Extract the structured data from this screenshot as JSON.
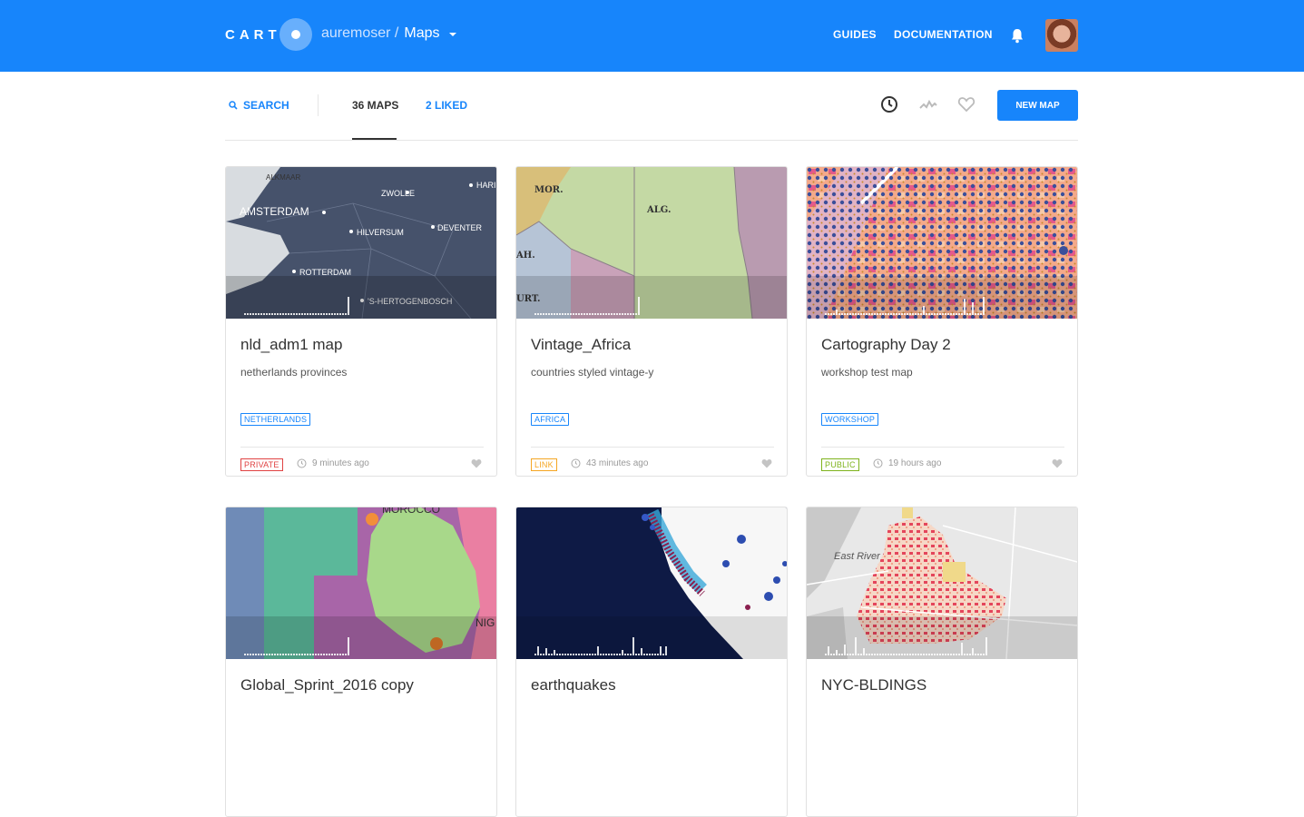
{
  "header": {
    "logo_text": "CART",
    "username": "auremoser /",
    "section": "Maps",
    "links": {
      "guides": "GUIDES",
      "documentation": "DOCUMENTATION"
    },
    "icons": [
      "bell-icon",
      "avatar"
    ]
  },
  "subnav": {
    "search": "SEARCH",
    "maps_tab": "36 MAPS",
    "liked_tab": "2 LIKED",
    "icons": [
      "clock-icon",
      "pulse-icon",
      "heart-icon"
    ],
    "new_map": "NEW MAP"
  },
  "colors": {
    "brand": "#1785fb",
    "private": "#e04343",
    "link": "#f5a623",
    "public": "#7eb31c"
  },
  "cards": [
    {
      "title": "nld_adm1 map",
      "description": "netherlands provinces",
      "tag": "NETHERLANDS",
      "privacy": "PRIVATE",
      "time": "9 minutes ago",
      "map_labels": [
        "ALKMAAR",
        "AMSTERDAM",
        "ZWOLLE",
        "HARI",
        "HILVERSUM",
        "DEVENTER",
        "ROTTERDAM",
        "'S-HERTOGENBOSCH"
      ]
    },
    {
      "title": "Vintage_Africa",
      "description": "countries styled vintage-y",
      "tag": "AFRICA",
      "privacy": "LINK",
      "time": "43 minutes ago",
      "map_labels": [
        "MOR.",
        "ALG.",
        "AH.",
        "URT."
      ]
    },
    {
      "title": "Cartography Day 2",
      "description": "workshop test map",
      "tag": "WORKSHOP",
      "privacy": "PUBLIC",
      "time": "19 hours ago"
    },
    {
      "title": "Global_Sprint_2016 copy",
      "map_labels": [
        "MOROCCO",
        "NIG"
      ]
    },
    {
      "title": "earthquakes"
    },
    {
      "title": "NYC-BLDINGS",
      "map_labels": [
        "East River"
      ]
    }
  ]
}
